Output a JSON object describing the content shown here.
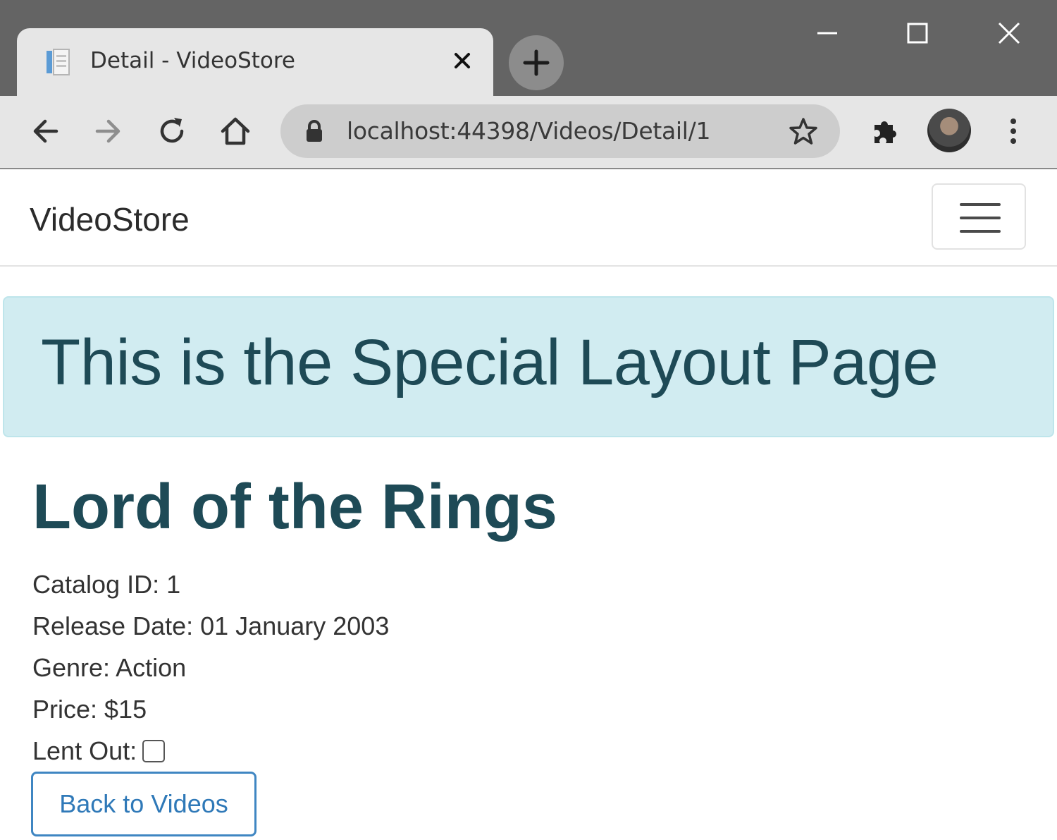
{
  "browser": {
    "tab_title": "Detail - VideoStore",
    "url": "localhost:44398/Videos/Detail/1"
  },
  "navbar": {
    "brand": "VideoStore"
  },
  "banner": {
    "text": "This is the Special Layout Page"
  },
  "video": {
    "title": "Lord of the Rings",
    "catalog_id": "Catalog ID: 1",
    "release_date": "Release Date: 01 January 2003",
    "genre": "Genre: Action",
    "price": "Price: $15",
    "lent_out_label": "Lent Out:",
    "lent_out_checked": false
  },
  "actions": {
    "back_label": "Back to Videos"
  },
  "colors": {
    "banner_bg": "#d1ecf1",
    "heading": "#1e4a56",
    "link_blue": "#2f79b8"
  }
}
